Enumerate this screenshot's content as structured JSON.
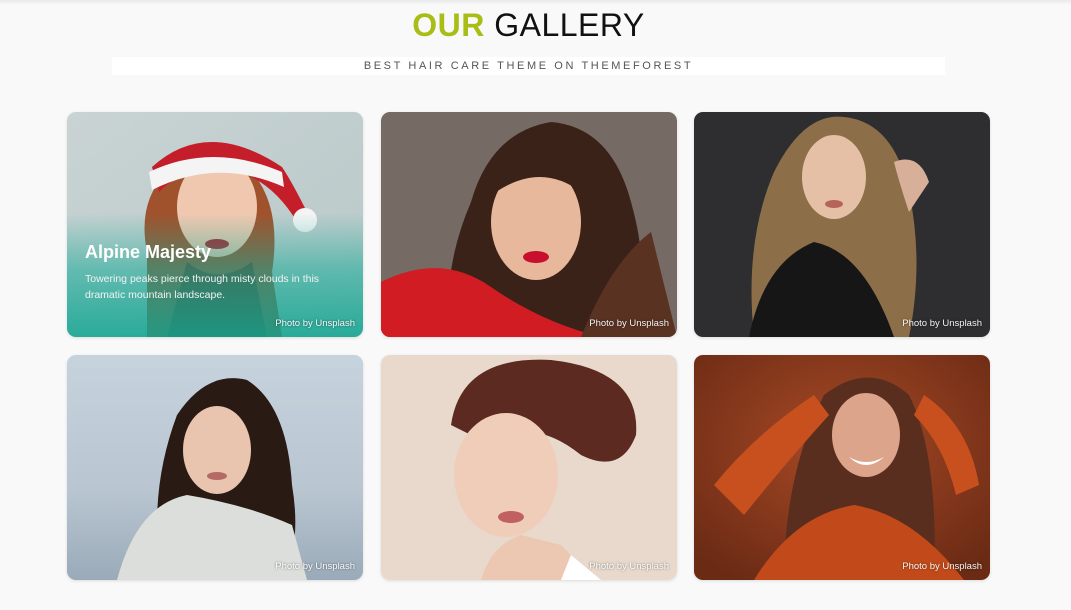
{
  "header": {
    "title_accent": "OUR",
    "title_rest": "GALLERY",
    "subtitle": "BEST HAIR CARE THEME ON THEMEFOREST"
  },
  "gallery": {
    "cards": [
      {
        "caption_title": "Alpine Majesty",
        "caption_text": "Towering peaks pierce through misty clouds in this dramatic mountain landscape.",
        "credit": "Photo by Unsplash"
      },
      {
        "credit": "Photo by Unsplash"
      },
      {
        "credit": "Photo by Unsplash"
      },
      {
        "credit": "Photo by Unsplash"
      },
      {
        "credit": "Photo by Unsplash"
      },
      {
        "credit": "Photo by Unsplash"
      }
    ]
  },
  "colors": {
    "accent": "#a8be16",
    "page_background": "#f9f9f9",
    "caption_overlay": "#14aa96"
  }
}
